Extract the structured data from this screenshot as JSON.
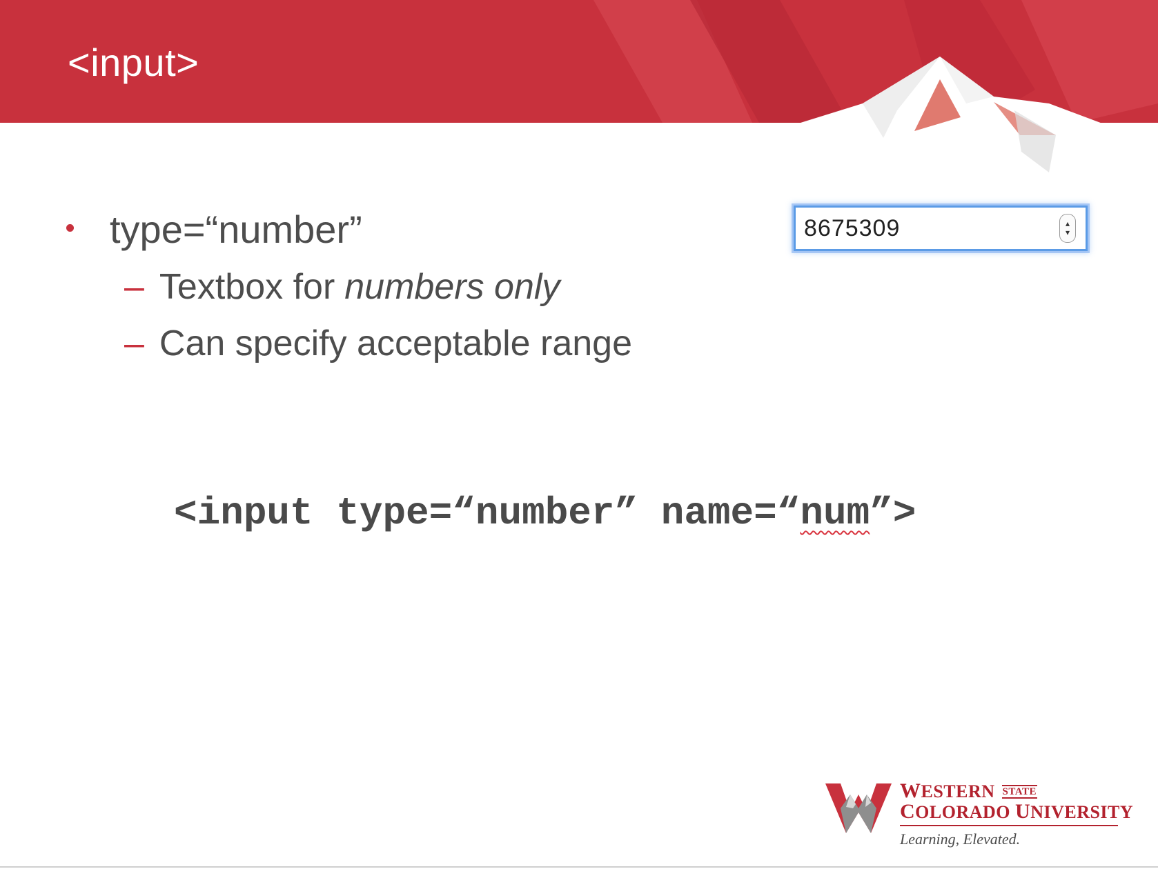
{
  "slide": {
    "title": "<input>",
    "colors": {
      "brand_red": "#c8313d",
      "text_gray": "#4d4d4d",
      "focus_blue": "#5b9be6"
    }
  },
  "bullets": {
    "level1": "type=“number”",
    "level2": [
      {
        "text": "Textbox for",
        "emphasis": "numbers only"
      },
      {
        "text": "Can specify acceptable range",
        "emphasis": ""
      }
    ]
  },
  "example_input": {
    "value": "8675309",
    "spinner_icon": "up-down-arrows-icon"
  },
  "code": {
    "before": "<input type=“number” name=“",
    "squiggle_word": "num",
    "after": "”>"
  },
  "logo": {
    "western_initial": "W",
    "western_rest": "ESTERN",
    "state": "STATE",
    "colorado_initial": "C",
    "colorado_rest": "OLORADO ",
    "university_initial": "U",
    "university_rest": "NIVERSITY",
    "tagline": "Learning, Elevated."
  }
}
